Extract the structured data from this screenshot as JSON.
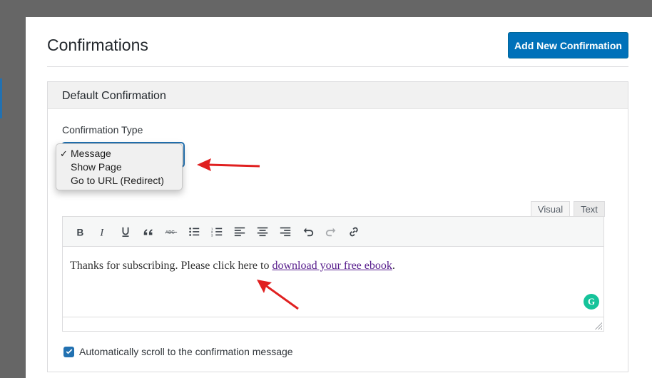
{
  "page": {
    "title": "Confirmations",
    "add_button_label": "Add New Confirmation"
  },
  "confirmation": {
    "header": "Default Confirmation",
    "type_label": "Confirmation Type",
    "type_options": [
      {
        "label": "Message",
        "selected": true
      },
      {
        "label": "Show Page",
        "selected": false
      },
      {
        "label": "Go to URL (Redirect)",
        "selected": false
      }
    ],
    "check_mark": "✓"
  },
  "editor": {
    "tabs": [
      "Visual",
      "Text"
    ],
    "active_tab": "Visual",
    "toolbar": [
      "bold",
      "italic",
      "underline",
      "blockquote",
      "strikethrough",
      "bulleted-list",
      "numbered-list",
      "align-left",
      "align-center",
      "align-right",
      "undo",
      "redo",
      "link"
    ],
    "content_text": "Thanks for subscribing. Please click here to ",
    "content_link": "download your free ebook",
    "content_end": ".",
    "grammarly_glyph": "G"
  },
  "auto_scroll": {
    "label": "Automatically scroll to the confirmation message",
    "checked": true
  },
  "colors": {
    "accent": "#0071b9",
    "arrow": "#e02020",
    "link": "#551a8b",
    "grammarly": "#15c39a"
  }
}
